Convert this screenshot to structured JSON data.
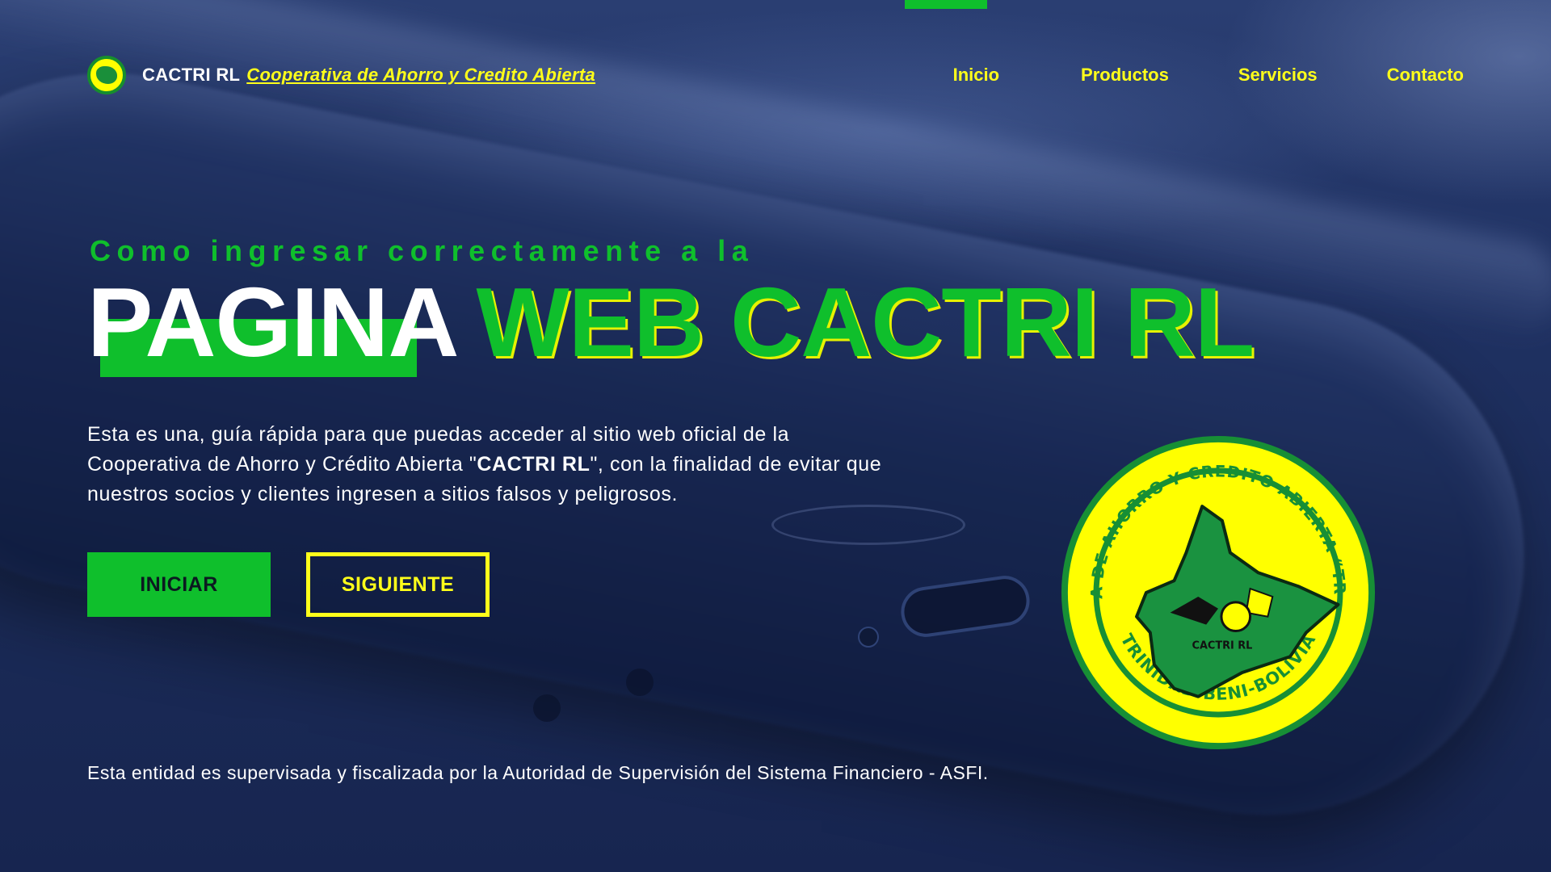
{
  "header": {
    "brand_name": "CACTRI RL",
    "brand_tagline": "Cooperativa de Ahorro y Credito Abierta",
    "nav": [
      {
        "label": "Inicio"
      },
      {
        "label": "Productos"
      },
      {
        "label": "Servicios"
      },
      {
        "label": "Contacto"
      }
    ]
  },
  "hero": {
    "kicker": "Como ingresar correctamente a la",
    "headline_white": "PAGINA",
    "headline_green": "WEB CACTRI RL",
    "description_part1": "Esta es una, guía rápida para que puedas acceder al sitio web oficial de la Cooperativa de Ahorro y Crédito Abierta \"",
    "description_bold": "CACTRI RL",
    "description_part2": "\", con la finalidad de evitar que nuestros socios y clientes ingresen a sitios falsos y peligrosos.",
    "primary_button": "INICIAR",
    "secondary_button": "SIGUIENTE"
  },
  "seal": {
    "top_text": "COOPERATIVA DE AHORRO Y CREDITO ABIERTA “TRINIDAD” R.L.",
    "bottom_text": "TRINIDAD-BENI-BOLIVIA",
    "center_text": "CACTRI RL"
  },
  "footer": {
    "disclaimer": "Esta entidad es supervisada y fiscalizada por la Autoridad de Supervisión del Sistema Financiero - ASFI."
  },
  "colors": {
    "background": "#1b2b55",
    "green": "#0fbf2c",
    "yellow": "#ffff1a",
    "white": "#ffffff"
  },
  "icons": {
    "brand": "cactri-logo-icon"
  }
}
